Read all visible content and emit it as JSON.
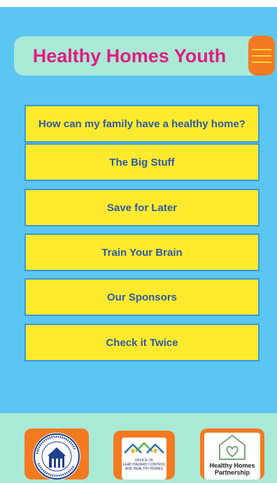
{
  "header": {
    "title": "Healthy Homes Youth"
  },
  "menu": {
    "icon": "hamburger-menu-icon"
  },
  "nav": {
    "items": [
      {
        "label": "How can my family have a healthy home?"
      },
      {
        "label": "The Big Stuff"
      },
      {
        "label": "Save for Later"
      },
      {
        "label": "Train Your Brain"
      },
      {
        "label": "Our Sponsors"
      },
      {
        "label": "Check it Twice"
      }
    ]
  },
  "sponsors": {
    "hud": {
      "seal_text": "U.S. DEPARTMENT OF HOUSING AND URBAN DEVELOPMENT"
    },
    "lead_office": {
      "line1": "OFFICE OF",
      "line2": "LEAD HAZARD CONTROL",
      "line3": "AND HEALTHY HOMES"
    },
    "hhp": {
      "line1": "Healthy Homes",
      "line2": "Partnership"
    }
  },
  "colors": {
    "background": "#5bc6f2",
    "header": "#a9ead7",
    "title": "#e11c82",
    "menu_button": "#f47a22",
    "nav_button": "#ffea2e",
    "nav_text": "#2f5aa8"
  }
}
